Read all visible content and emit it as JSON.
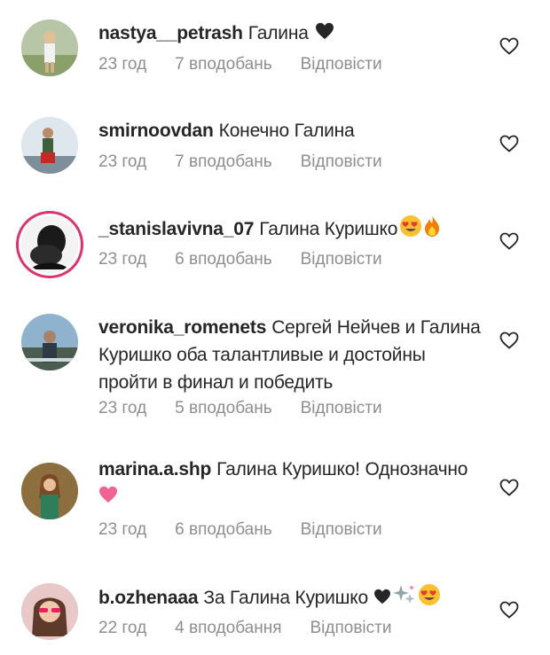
{
  "comments": [
    {
      "username": "nastya__petrash",
      "text": "Галина",
      "time": "23 год",
      "likes": "7 вподобань",
      "reply": "Відповісти"
    },
    {
      "username": "smirnoovdan",
      "text": "Конечно Галина",
      "time": "23 год",
      "likes": "7 вподобань",
      "reply": "Відповісти"
    },
    {
      "username": "_stanislavivna_07",
      "text": "Галина Куришко",
      "time": "23 год",
      "likes": "6 вподобань",
      "reply": "Відповісти"
    },
    {
      "username": "veronika_romenets",
      "text": "Сергей Нейчев и Галина Куришко оба талантливые и достойны пройти в финал и победить",
      "time": "23 год",
      "likes": "5 вподобань",
      "reply": "Відповісти"
    },
    {
      "username": "marina.a.shp",
      "text": "Галина Куришко! Однозначно",
      "time": "23 год",
      "likes": "6 вподобань",
      "reply": "Відповісти"
    },
    {
      "username": "b.ozhenaaa",
      "text": "За Галина Куришко",
      "time": "22 год",
      "likes": "4 вподобання",
      "reply": "Відповісти"
    }
  ],
  "colors": {
    "text": "#262626",
    "meta": "#8e8e8e",
    "story_ring": "#e1306c",
    "heart": "#262626",
    "pink_heart": "#f06292"
  },
  "icons": [
    "heart-outline-icon",
    "black-heart-emoji",
    "heart-eyes-emoji",
    "fire-emoji",
    "pink-heart-emoji",
    "sparkles-emoji"
  ]
}
